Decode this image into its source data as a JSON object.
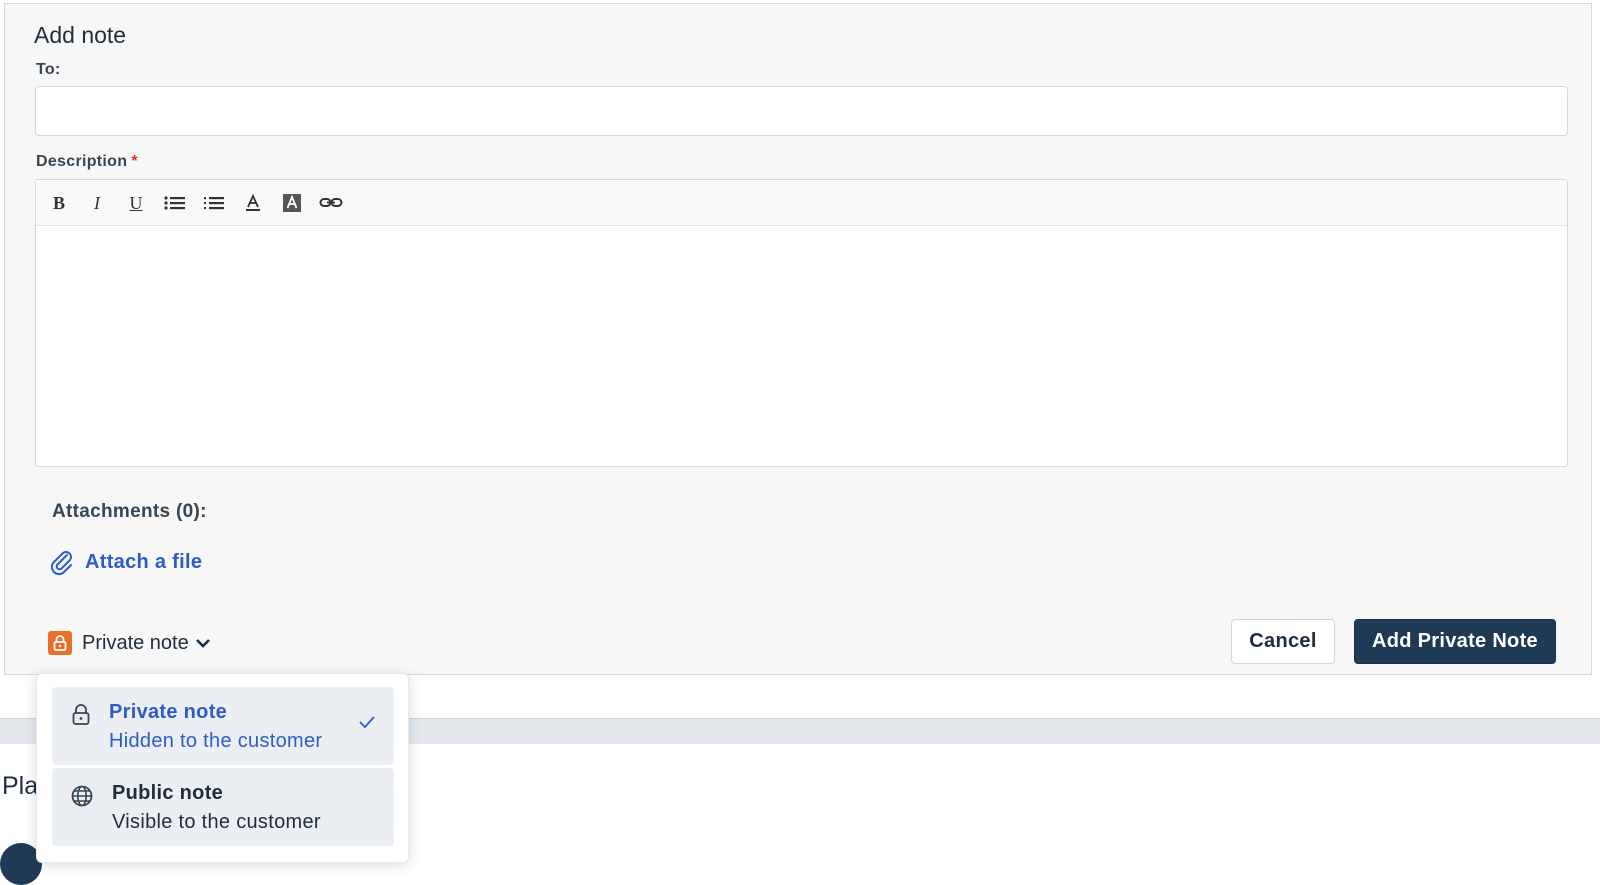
{
  "form": {
    "title": "Add note",
    "to_label": "To:",
    "to_value": "",
    "description_label": "Description",
    "required_mark": "*",
    "attachments_label": "Attachments (0):",
    "attach_link": "Attach a file",
    "note_type_selected": "Private note"
  },
  "toolbar": {
    "bold": "B",
    "italic": "I",
    "underline": "U",
    "icons": [
      "bold-icon",
      "italic-icon",
      "underline-icon",
      "bullet-list-icon",
      "numbered-list-icon",
      "font-color-icon",
      "highlight-color-icon",
      "link-icon"
    ]
  },
  "actions": {
    "cancel_label": "Cancel",
    "submit_label": "Add Private Note"
  },
  "dropdown": {
    "options": [
      {
        "title": "Private note",
        "subtitle": "Hidden to the customer",
        "icon": "lock-icon",
        "selected": true
      },
      {
        "title": "Public note",
        "subtitle": "Visible to the customer",
        "icon": "globe-icon",
        "selected": false
      }
    ]
  },
  "background": {
    "partial_text": "Pla"
  },
  "colors": {
    "primary": "#1e3a55",
    "link": "#2c5cc5",
    "private_badge": "#e86f25",
    "required": "#d72d30"
  }
}
